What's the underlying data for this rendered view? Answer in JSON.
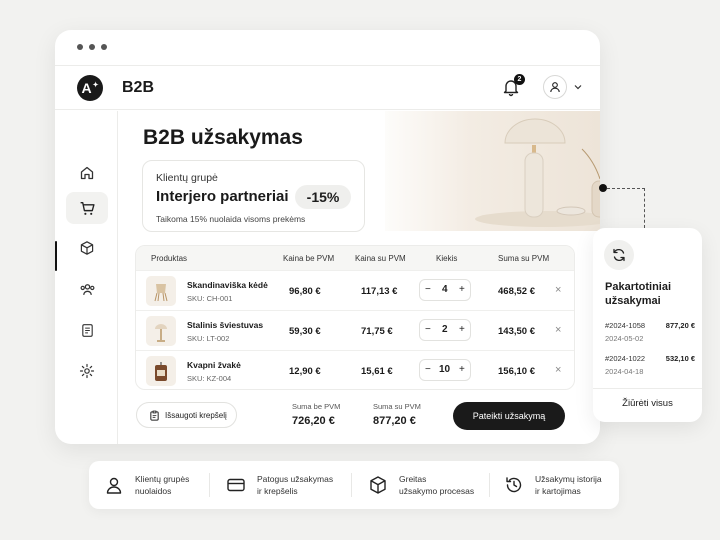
{
  "app": {
    "brand": "B2B",
    "notifications_count": "2"
  },
  "page": {
    "title": "B2B užsakymas"
  },
  "customer_group": {
    "label": "Klientų grupė",
    "name": "Interjero partneriai",
    "discount": "-15%",
    "note": "Taikoma 15% nuolaida visoms prekėms"
  },
  "table": {
    "headers": [
      "Produktas",
      "Kaina be PVM",
      "Kaina su PVM",
      "Kiekis",
      "Suma su PVM"
    ],
    "rows": [
      {
        "name": "Skandinaviška kėdė",
        "sku": "SKU: CH-001",
        "price_ex": "96,80 €",
        "price_inc": "117,13 €",
        "qty": "4",
        "sum": "468,52 €",
        "thumb_icon": "chair-icon"
      },
      {
        "name": "Stalinis šviestuvas",
        "sku": "SKU: LT-002",
        "price_ex": "59,30 €",
        "price_inc": "71,75 €",
        "qty": "2",
        "sum": "143,50 €",
        "thumb_icon": "lamp-icon"
      },
      {
        "name": "Kvapni žvakė",
        "sku": "SKU: KZ-004",
        "price_ex": "12,90 €",
        "price_inc": "15,61 €",
        "qty": "10",
        "sum": "156,10 €",
        "thumb_icon": "candle-icon"
      }
    ],
    "minus": "−",
    "plus": "+",
    "remove": "×"
  },
  "footer": {
    "save_label": "Išsaugoti krepšelį",
    "total_ex_label": "Suma be PVM",
    "total_ex": "726,20 €",
    "total_inc_label": "Suma su PVM",
    "total_inc": "877,20 €",
    "submit_label": "Pateikti užsakymą"
  },
  "reorder": {
    "title": "Pakartotiniai užsakymai",
    "orders": [
      {
        "id": "#2024-1058",
        "amount": "877,20 €",
        "date": "2024-05-02"
      },
      {
        "id": "#2024-1022",
        "amount": "532,10 €",
        "date": "2024-04-18"
      }
    ],
    "view_all": "Žiūrėti visus"
  },
  "features": [
    {
      "line1": "Klientų grupės",
      "line2": "nuolaidos",
      "icon": "user-badge-icon"
    },
    {
      "line1": "Patogus užsakymas",
      "line2": "ir krepšelis",
      "icon": "card-icon"
    },
    {
      "line1": "Greitas",
      "line2": "užsakymo procesas",
      "icon": "box-icon"
    },
    {
      "line1": "Užsakymų istorija",
      "line2": "ir kartojimas",
      "icon": "history-icon"
    }
  ],
  "sidebar": [
    "home-icon",
    "cart-icon",
    "box-icon",
    "users-icon",
    "document-icon",
    "settings-icon"
  ],
  "colors": {
    "accent": "#1a1a1a",
    "background": "#f2f2f0",
    "pill": "#efefed"
  }
}
